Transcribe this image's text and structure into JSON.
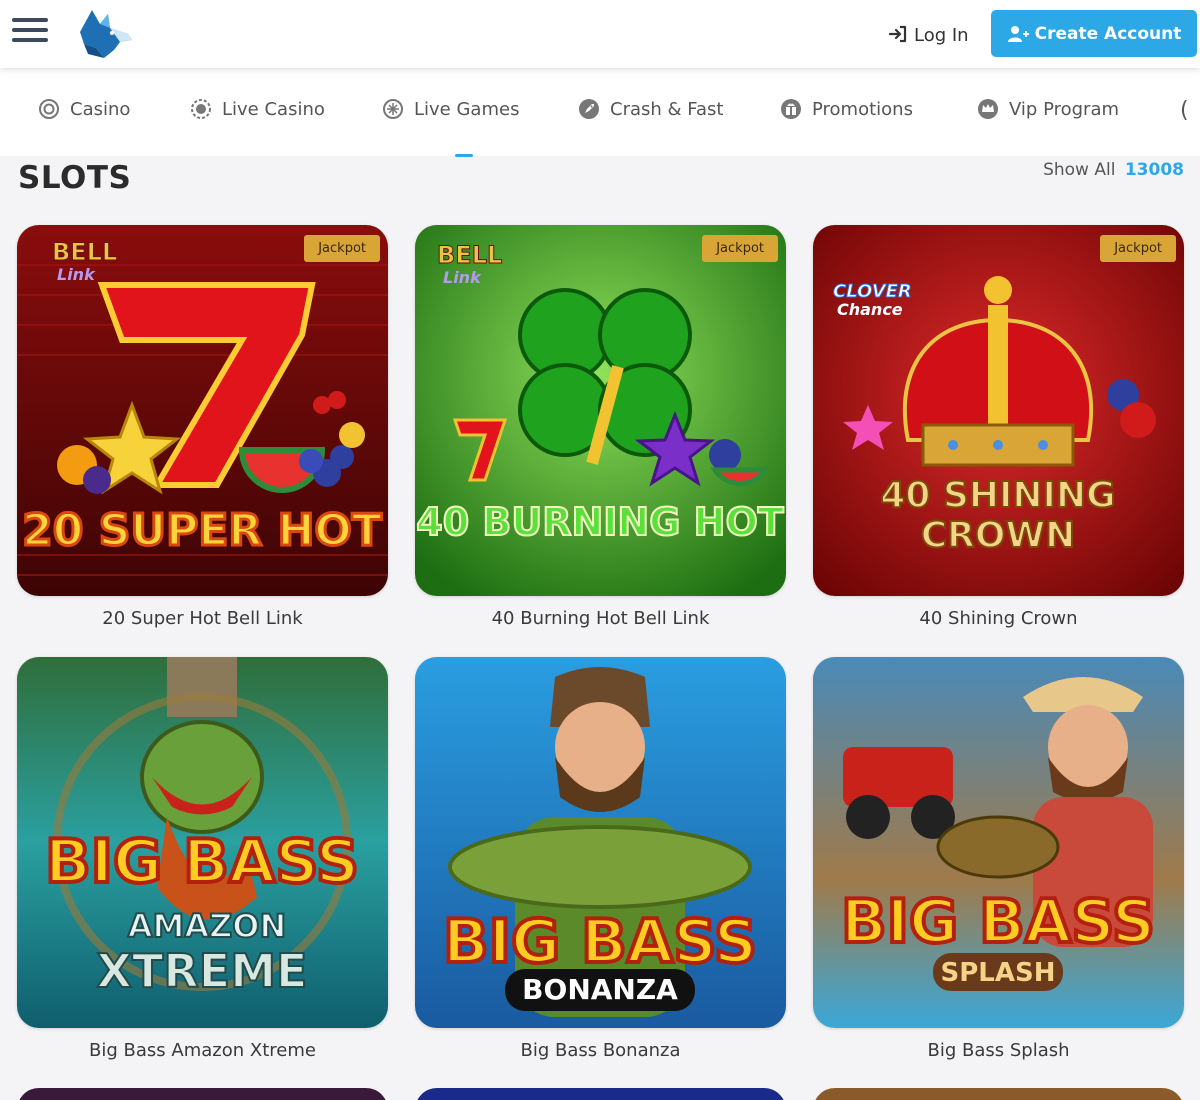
{
  "header": {
    "login_label": "Log In",
    "create_account_label": "Create Account"
  },
  "nav": {
    "items": [
      {
        "label": "Casino",
        "icon": "casino-chip-icon"
      },
      {
        "label": "Live Casino",
        "icon": "live-casino-icon"
      },
      {
        "label": "Live Games",
        "icon": "live-games-icon"
      },
      {
        "label": "Crash & Fast",
        "icon": "rocket-icon"
      },
      {
        "label": "Promotions",
        "icon": "gift-icon"
      },
      {
        "label": "Vip Program",
        "icon": "crown-icon"
      }
    ]
  },
  "section": {
    "title": "SLOTS",
    "show_all_label": "Show All",
    "count": "13008"
  },
  "games": [
    {
      "title": "20 Super Hot Bell Link",
      "badge": "Jackpot",
      "art_line1": "20 SUPER HOT",
      "art_line2": "",
      "brand": "BELL Link"
    },
    {
      "title": "40 Burning Hot Bell Link",
      "badge": "Jackpot",
      "art_line1": "40 BURNING HOT",
      "art_line2": "",
      "brand": "BELL Link"
    },
    {
      "title": "40 Shining Crown",
      "badge": "Jackpot",
      "art_line1": "40 SHINING",
      "art_line2": "CROWN",
      "brand": "CLOVER Chance"
    },
    {
      "title": "Big Bass Amazon Xtreme",
      "badge": "",
      "art_line1": "BIG BASS",
      "art_line2": "AMAZON XTREME",
      "brand": ""
    },
    {
      "title": "Big Bass Bonanza",
      "badge": "",
      "art_line1": "BIG BASS",
      "art_line2": "BONANZA",
      "brand": ""
    },
    {
      "title": "Big Bass Splash",
      "badge": "",
      "art_line1": "BIG BASS",
      "art_line2": "SPLASH",
      "brand": ""
    }
  ],
  "colors": {
    "accent": "#2da8e6",
    "badge": "#d9a536",
    "background": "#f4f4f6"
  }
}
